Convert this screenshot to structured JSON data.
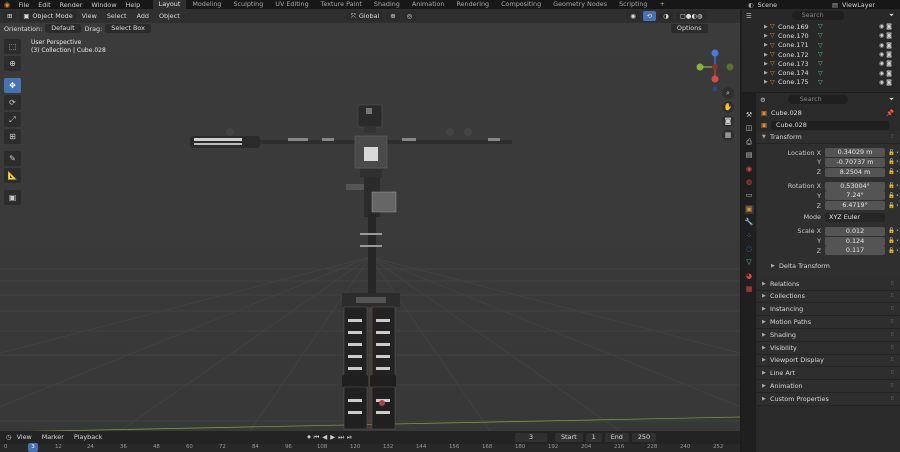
{
  "topbar": {
    "menus": [
      "File",
      "Edit",
      "Render",
      "Window",
      "Help"
    ],
    "workspaces": [
      "Layout",
      "Modeling",
      "Sculpting",
      "UV Editing",
      "Texture Paint",
      "Shading",
      "Animation",
      "Rendering",
      "Compositing",
      "Geometry Nodes",
      "Scripting"
    ],
    "active_workspace": "Layout",
    "add_tab": "+",
    "scene": "Scene",
    "view_layer": "ViewLayer"
  },
  "viewport": {
    "mode": "Object Mode",
    "menus": [
      "View",
      "Select",
      "Add",
      "Object"
    ],
    "transform_space": "Global",
    "options": "Options",
    "orientation_label": "Orientation:",
    "orientation_value": "Default",
    "drag_label": "Drag:",
    "drag_value": "Select Box",
    "info_line1": "User Perspective",
    "info_line2": "(3) Collection | Cube.028"
  },
  "timeline": {
    "menus": [
      "View",
      "Marker",
      "Playback"
    ],
    "current_frame": "3",
    "start_label": "Start",
    "start_value": "1",
    "end_label": "End",
    "end_value": "250",
    "ruler": [
      "0",
      "12",
      "24",
      "36",
      "48",
      "60",
      "72",
      "84",
      "96",
      "108",
      "120",
      "132",
      "144",
      "156",
      "168",
      "180",
      "192",
      "204",
      "216",
      "228",
      "240",
      "252"
    ],
    "ruler_current": "3"
  },
  "outliner": {
    "search_placeholder": "Search",
    "items": [
      {
        "name": "Cone.169"
      },
      {
        "name": "Cone.170"
      },
      {
        "name": "Cone.171"
      },
      {
        "name": "Cone.172"
      },
      {
        "name": "Cone.173"
      },
      {
        "name": "Cone.174"
      },
      {
        "name": "Cone.175"
      }
    ]
  },
  "properties": {
    "search_placeholder": "Search",
    "object_name": "Cube.028",
    "object_field": "Cube.028",
    "transform": {
      "title": "Transform",
      "location_label": "Location X",
      "location": [
        "0.34029 m",
        "-0.70737 m",
        "8.2504 m"
      ],
      "rotation_label": "Rotation X",
      "rotation": [
        "0.53004°",
        "7.24°",
        "6.4719°"
      ],
      "mode_label": "Mode",
      "mode_value": "XYZ Euler",
      "scale_label": "Scale X",
      "scale": [
        "0.012",
        "0.124",
        "0.117"
      ],
      "axis_y": "Y",
      "axis_z": "Z",
      "delta": "Delta Transform"
    },
    "panels": [
      "Relations",
      "Collections",
      "Instancing",
      "Motion Paths",
      "Shading",
      "Visibility",
      "Viewport Display",
      "Line Art",
      "Animation",
      "Custom Properties"
    ]
  },
  "colors": {
    "accent": "#4772b3",
    "viewport_bg": "#3a3a3a",
    "cone_icon": "#e0902f",
    "mesh_icon": "#55c985"
  }
}
